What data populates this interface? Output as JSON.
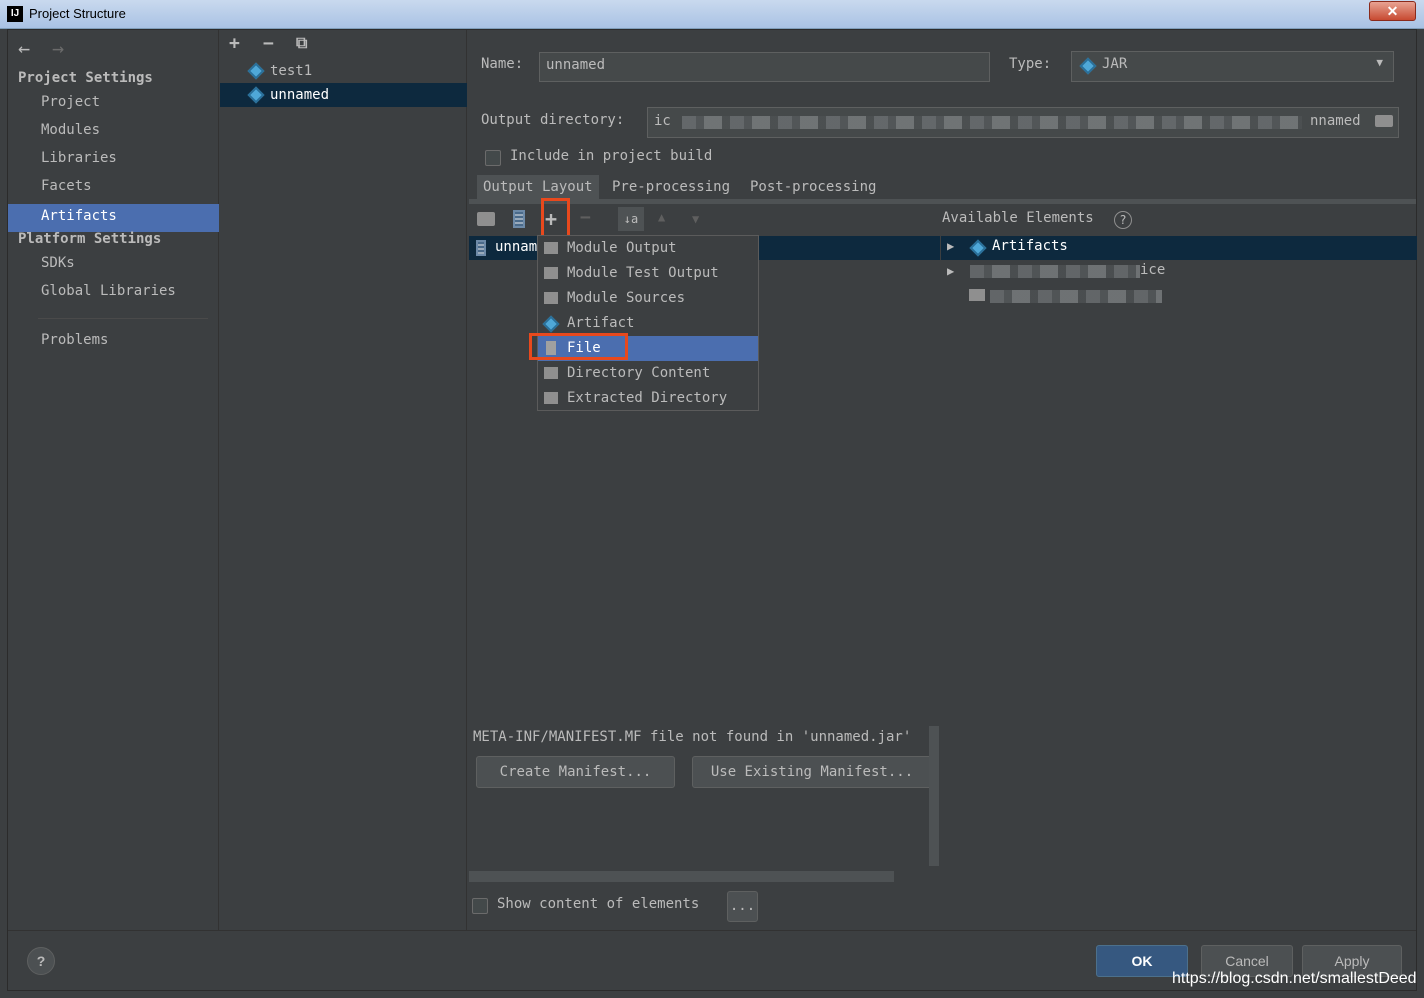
{
  "window": {
    "title": "Project Structure",
    "close": "✕",
    "app_icon": "IJ"
  },
  "sidebar": {
    "back": "←",
    "forward": "→",
    "project_settings_title": "Project Settings",
    "project_items": [
      "Project",
      "Modules",
      "Libraries",
      "Facets",
      "Artifacts"
    ],
    "platform_settings_title": "Platform Settings",
    "platform_items": [
      "SDKs",
      "Global Libraries"
    ],
    "problems": "Problems",
    "help": "?"
  },
  "artifacts_list": {
    "add": "+",
    "remove": "−",
    "copy": "⧉",
    "items": [
      "test1",
      "unnamed"
    ]
  },
  "form": {
    "name_label": "Name:",
    "name_value": "unnamed",
    "type_label": "Type:",
    "type_value": "JAR",
    "output_label": "Output directory:",
    "output_prefix": "ic",
    "output_suffix": "nnamed",
    "include_label": "Include in project build"
  },
  "tabs": [
    "Output Layout",
    "Pre-processing",
    "Post-processing"
  ],
  "layout_toolbar": {
    "add": "+",
    "remove": "−",
    "sort": "↓a"
  },
  "layout_tree": {
    "root": "unnam"
  },
  "available": {
    "title": "Available Elements",
    "help": "?",
    "artifacts": "Artifacts",
    "item2_suffix": "ice"
  },
  "add_menu": [
    "Module Output",
    "Module Test Output",
    "Module Sources",
    "Artifact",
    "File",
    "Directory Content",
    "Extracted Directory"
  ],
  "manifest": {
    "message": "META-INF/MANIFEST.MF file not found in 'unnamed.jar'",
    "create": "Create Manifest...",
    "use_existing": "Use Existing Manifest..."
  },
  "show_content": {
    "label": "Show content of elements",
    "more": "..."
  },
  "buttons": {
    "ok": "OK",
    "cancel": "Cancel",
    "apply": "Apply"
  },
  "watermark": "https://blog.csdn.net/smallestDeed",
  "colors": {
    "background": "#3c3f41",
    "selection": "#4b6eaf",
    "highlight": "#e8491d"
  }
}
